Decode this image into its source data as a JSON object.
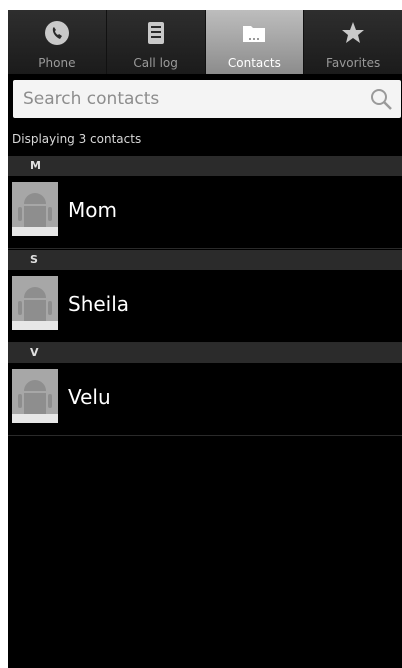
{
  "tabs": [
    {
      "label": "Phone",
      "icon": "phone-icon",
      "active": false
    },
    {
      "label": "Call log",
      "icon": "call-log-icon",
      "active": false
    },
    {
      "label": "Contacts",
      "icon": "contacts-folder-icon",
      "active": true
    },
    {
      "label": "Favorites",
      "icon": "star-icon",
      "active": false
    }
  ],
  "search": {
    "placeholder": "Search contacts",
    "value": "",
    "icon": "search-icon"
  },
  "count_text": "Displaying 3 contacts",
  "sections": [
    {
      "letter": "M",
      "contacts": [
        {
          "name": "Mom",
          "avatar": "android-avatar-icon"
        }
      ]
    },
    {
      "letter": "S",
      "contacts": [
        {
          "name": "Sheila",
          "avatar": "android-avatar-icon"
        }
      ]
    },
    {
      "letter": "V",
      "contacts": [
        {
          "name": "Velu",
          "avatar": "android-avatar-icon"
        }
      ]
    }
  ],
  "colors": {
    "background": "#000000",
    "section_header": "#2b2b2b",
    "active_tab": "#a8a8a8",
    "search_bg": "#f4f4f4"
  }
}
